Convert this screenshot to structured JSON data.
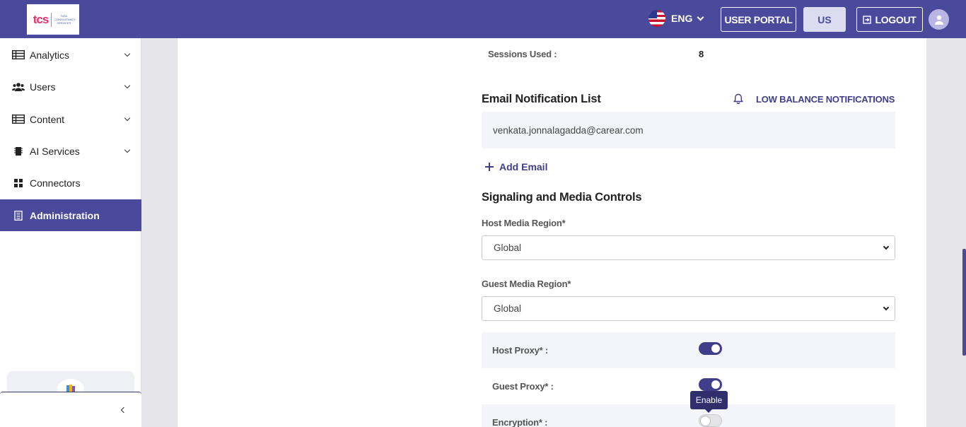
{
  "header": {
    "logo_text": "tcs",
    "logo_subtext": "TATA CONSULTANCY SERVICES",
    "language": "ENG",
    "user_portal_label": "USER PORTAL",
    "region_label": "US",
    "logout_label": "LOGOUT",
    "brand_color": "#4a4a9c"
  },
  "sidebar": {
    "items": [
      {
        "label": "Analytics",
        "icon": "table-icon",
        "expandable": true
      },
      {
        "label": "Users",
        "icon": "users-icon",
        "expandable": true
      },
      {
        "label": "Content",
        "icon": "table-icon",
        "expandable": true
      },
      {
        "label": "AI Services",
        "icon": "chip-icon",
        "expandable": true
      },
      {
        "label": "Connectors",
        "icon": "grid-icon",
        "expandable": false
      },
      {
        "label": "Administration",
        "icon": "building-icon",
        "expandable": false,
        "active": true
      }
    ]
  },
  "main": {
    "sessions_used_label": "Sessions Used :",
    "sessions_used_value": "8",
    "email_section_title": "Email Notification List",
    "low_balance_label": "LOW BALANCE NOTIFICATIONS",
    "emails": [
      "venkata.jonnalagadda@carear.com"
    ],
    "add_email_label": "Add Email",
    "signaling_title": "Signaling and Media Controls",
    "host_media_region_label": "Host Media Region*",
    "host_media_region_value": "Global",
    "guest_media_region_label": "Guest Media Region*",
    "guest_media_region_value": "Global",
    "host_proxy_label": "Host Proxy* :",
    "host_proxy_on": true,
    "guest_proxy_label": "Guest Proxy* :",
    "guest_proxy_on": true,
    "encryption_label": "Encryption* :",
    "encryption_on": false,
    "tooltip_text": "Enable"
  }
}
